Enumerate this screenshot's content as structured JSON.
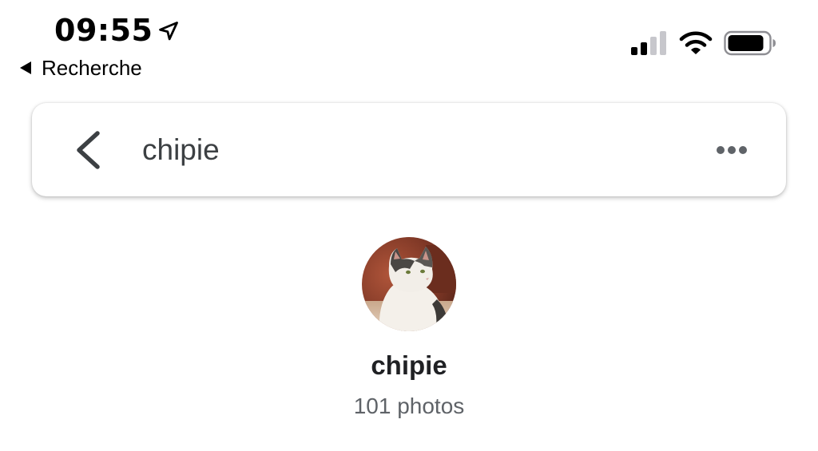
{
  "status_bar": {
    "time": "09:55",
    "back_app_label": "Recherche",
    "location_icon": "location-arrow-icon",
    "signal_icon": "cellular-signal-icon",
    "wifi_icon": "wifi-icon",
    "battery_icon": "battery-icon"
  },
  "search_bar": {
    "query": "chipie",
    "back_icon": "chevron-left-icon",
    "more_icon": "more-horizontal-icon"
  },
  "result": {
    "name": "chipie",
    "count_label": "101 photos",
    "avatar_subject": "cat-photo"
  },
  "colors": {
    "background": "#ffffff",
    "query_text": "#3c4043",
    "secondary_text": "#5f6368",
    "icon_gray": "#5f6368"
  }
}
